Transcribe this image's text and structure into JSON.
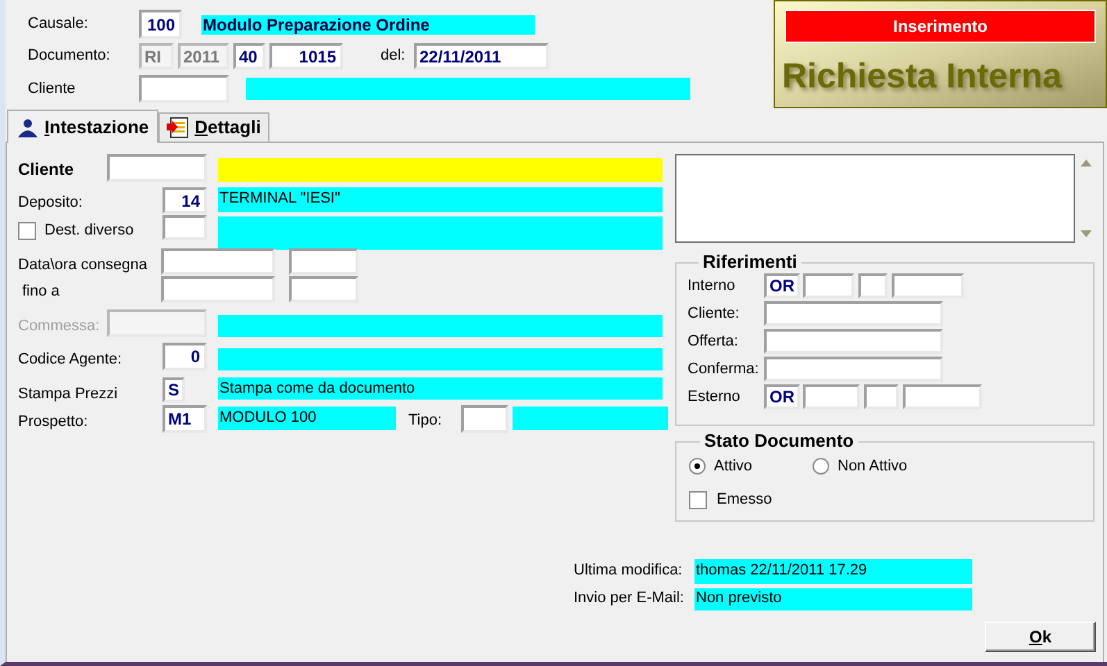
{
  "header": {
    "causale": {
      "label": "Causale:",
      "code": "100",
      "description": "Modulo Preparazione Ordine"
    },
    "documento": {
      "label": "Documento:",
      "parts": [
        {
          "value": "RI",
          "disabled": true
        },
        {
          "value": "2011",
          "disabled": true
        },
        {
          "value": "40",
          "disabled": false
        },
        {
          "value": "1015",
          "disabled": false
        }
      ],
      "date_label": "del:",
      "date": "22/11/2011"
    },
    "cliente": {
      "label": "Cliente"
    }
  },
  "status_panel": {
    "mode": "Inserimento",
    "title": "Richiesta Interna"
  },
  "tabs": [
    {
      "label": "Intestazione",
      "selected": true,
      "kind": "person"
    },
    {
      "label": "Dettagli",
      "selected": false,
      "kind": "document"
    }
  ],
  "intestazione": {
    "cliente": {
      "label": "Cliente"
    },
    "deposito": {
      "label": "Deposito:",
      "code": "14",
      "description": "TERMINAL \"IESI\""
    },
    "dest_diverso": {
      "label": "Dest. diverso",
      "checked": false
    },
    "consegna": {
      "label": "Data\\ora consegna"
    },
    "fino_a": {
      "label": "fino a"
    },
    "commessa": {
      "label": "Commessa:",
      "disabled": true
    },
    "codice_agente": {
      "label": "Codice Agente:",
      "code": "0"
    },
    "stampa_prezzi": {
      "label": "Stampa Prezzi",
      "code": "S",
      "description": "Stampa come da documento"
    },
    "prospetto": {
      "label": "Prospetto:",
      "code": "M1",
      "description": "MODULO 100",
      "tipo_label": "Tipo:"
    }
  },
  "riferimenti": {
    "title": "Riferimenti",
    "rows": [
      {
        "label": "Interno",
        "kind": "coded",
        "prefix": "OR"
      },
      {
        "label": "Cliente:",
        "kind": "plain"
      },
      {
        "label": "Offerta:",
        "kind": "plain"
      },
      {
        "label": "Conferma:",
        "kind": "plain"
      },
      {
        "label": "Esterno",
        "kind": "coded",
        "prefix": "OR"
      }
    ]
  },
  "stato_documento": {
    "title": "Stato Documento",
    "options": [
      {
        "label": "Attivo",
        "selected": true
      },
      {
        "label": "Non Attivo",
        "selected": false
      }
    ],
    "emesso": {
      "label": "Emesso",
      "checked": false
    }
  },
  "footer": {
    "ultima_modifica": {
      "label": "Ultima modifica:",
      "value": "thomas 22/11/2011 17.29"
    },
    "invio_email": {
      "label": "Invio per E-Mail:",
      "value": "Non previsto"
    },
    "ok_button": "Ok"
  }
}
